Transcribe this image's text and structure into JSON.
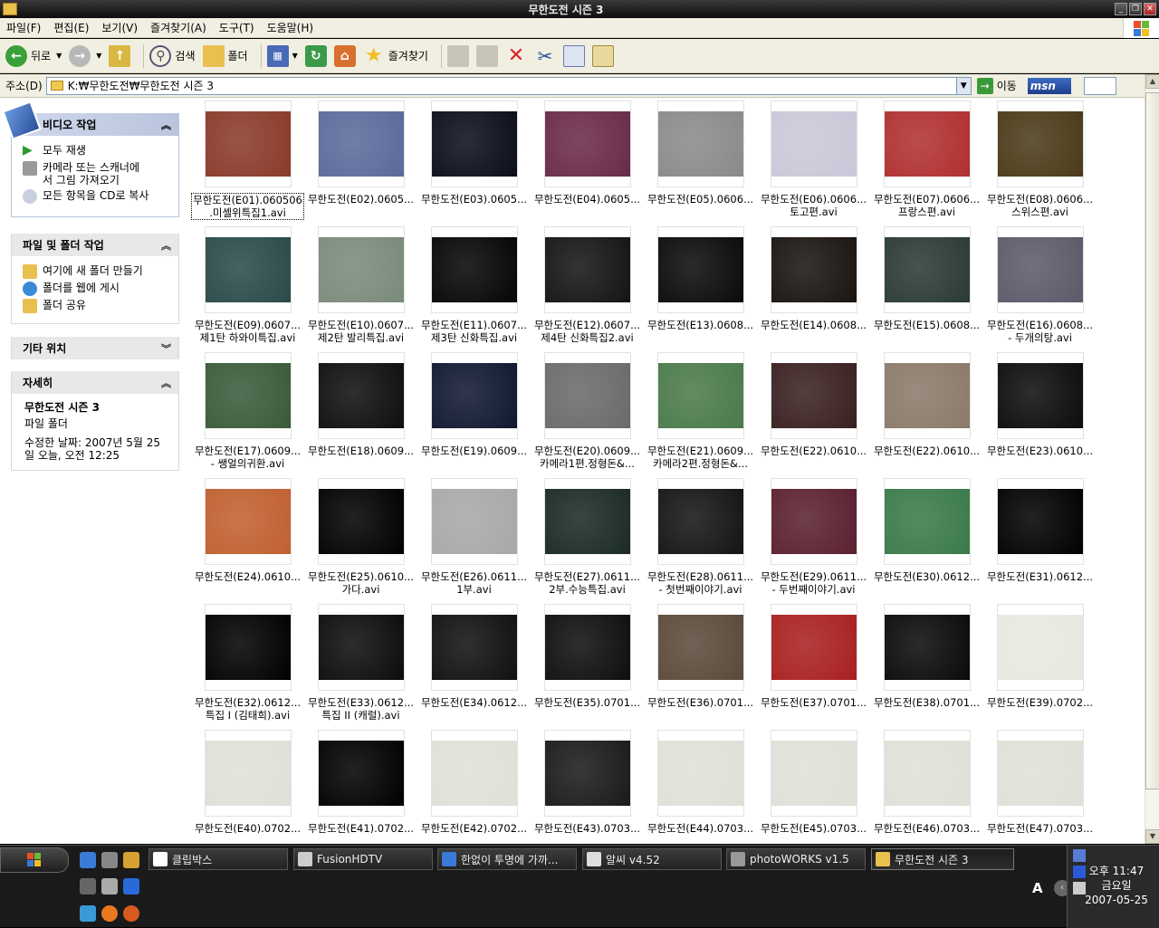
{
  "window": {
    "title": "무한도전 시즌 3"
  },
  "menu": [
    "파일(F)",
    "편집(E)",
    "보기(V)",
    "즐겨찾기(A)",
    "도구(T)",
    "도움말(H)"
  ],
  "toolbar": {
    "back": "뒤로",
    "search": "검색",
    "folders": "폴더",
    "favorites": "즐겨찾기"
  },
  "address": {
    "label": "주소(D)",
    "path": "K:₩무한도전₩무한도전 시즌 3",
    "go": "이동",
    "msn": "msn"
  },
  "sidebar": {
    "video_tasks": {
      "title": "비디오 작업",
      "items": [
        "모두 재생",
        "카메라 또는 스캐너에\n서 그림 가져오기",
        "모든 항목을 CD로 복사"
      ]
    },
    "file_tasks": {
      "title": "파일 및 폴더 작업",
      "items": [
        "여기에 새 폴더 만들기",
        "폴더를 웹에 게시",
        "폴더 공유"
      ]
    },
    "other_places": {
      "title": "기타 위치"
    },
    "details": {
      "title": "자세히",
      "name": "무한도전 시즌 3",
      "type": "파일 폴더",
      "modified": "수정한 날짜: 2007년 5월 25\n일 오늘, 오전 12:25"
    }
  },
  "files": [
    {
      "l1": "무한도전(E01).060506",
      "l2": ".미셸위특집1.avi",
      "c": "#8a3a2a"
    },
    {
      "l1": "무한도전(E02).0605...",
      "l2": "",
      "c": "#5a6a9a"
    },
    {
      "l1": "무한도전(E03).0605...",
      "l2": "",
      "c": "#0a0e1a"
    },
    {
      "l1": "무한도전(E04).0605...",
      "l2": "",
      "c": "#6a2a4a"
    },
    {
      "l1": "무한도전(E05).0606...",
      "l2": "",
      "c": "#8a8a8a"
    },
    {
      "l1": "무한도전(E06).0606...",
      "l2": "토고편.avi",
      "c": "#c8c8d8"
    },
    {
      "l1": "무한도전(E07).0606...",
      "l2": "프랑스편.avi",
      "c": "#b03030"
    },
    {
      "l1": "무한도전(E08).0606...",
      "l2": "스위스편.avi",
      "c": "#4a3a18"
    },
    {
      "l1": "무한도전(E09).0607...",
      "l2": "제1탄 하와이특집.avi",
      "c": "#2a4a4a"
    },
    {
      "l1": "무한도전(E10).0607...",
      "l2": "제2탄 발리특집.avi",
      "c": "#7a8a7a"
    },
    {
      "l1": "무한도전(E11).0607...",
      "l2": "제3탄 신화특집.avi",
      "c": "#050505"
    },
    {
      "l1": "무한도전(E12).0607...",
      "l2": "제4탄 신화특집2.avi",
      "c": "#141414"
    },
    {
      "l1": "무한도전(E13).0608...",
      "l2": "",
      "c": "#0a0a0a"
    },
    {
      "l1": "무한도전(E14).0608...",
      "l2": "",
      "c": "#1a1410"
    },
    {
      "l1": "무한도전(E15).0608...",
      "l2": "",
      "c": "#2a3a34"
    },
    {
      "l1": "무한도전(E16).0608...",
      "l2": "- 두개의탕.avi",
      "c": "#5a5a6a"
    },
    {
      "l1": "무한도전(E17).0609...",
      "l2": "- 쌩얼의귀환.avi",
      "c": "#3a5a3a"
    },
    {
      "l1": "무한도전(E18).0609...",
      "l2": "",
      "c": "#0e0e0e"
    },
    {
      "l1": "무한도전(E19).0609...",
      "l2": "",
      "c": "#101830"
    },
    {
      "l1": "무한도전(E20).0609...",
      "l2": "카메라1편.정형돈&...",
      "c": "#6a6a6a"
    },
    {
      "l1": "무한도전(E21).0609...",
      "l2": "카메라2편.정형돈&...",
      "c": "#4a7a4a"
    },
    {
      "l1": "무한도전(E22).0610...",
      "l2": "",
      "c": "#3a2020"
    },
    {
      "l1": "무한도전(E22).0610...",
      "l2": "",
      "c": "#8a7a6a"
    },
    {
      "l1": "무한도전(E23).0610...",
      "l2": "",
      "c": "#0c0c0c"
    },
    {
      "l1": "무한도전(E24).0610...",
      "l2": "",
      "c": "#c06030"
    },
    {
      "l1": "무한도전(E25).0610...",
      "l2": "가다.avi",
      "c": "#000000"
    },
    {
      "l1": "무한도전(E26).0611...",
      "l2": "1부.avi",
      "c": "#a8a8a8"
    },
    {
      "l1": "무한도전(E27).0611...",
      "l2": "2부.수능특집.avi",
      "c": "#1a2a24"
    },
    {
      "l1": "무한도전(E28).0611...",
      "l2": "- 첫번째이야기.avi",
      "c": "#141414"
    },
    {
      "l1": "무한도전(E29).0611...",
      "l2": "- 두번째이야기.avi",
      "c": "#5a2030"
    },
    {
      "l1": "무한도전(E30).0612...",
      "l2": "",
      "c": "#3a7a4a"
    },
    {
      "l1": "무한도전(E31).0612...",
      "l2": "",
      "c": "#000000"
    },
    {
      "l1": "무한도전(E32).0612...",
      "l2": "특집 I (김태희).avi",
      "c": "#000000"
    },
    {
      "l1": "무한도전(E33).0612...",
      "l2": "특집 II (캐럴).avi",
      "c": "#0c0c0c"
    },
    {
      "l1": "무한도전(E34).0612...",
      "l2": "",
      "c": "#101010"
    },
    {
      "l1": "무한도전(E35).0701...",
      "l2": "",
      "c": "#0e0e0e"
    },
    {
      "l1": "무한도전(E36).0701...",
      "l2": "",
      "c": "#5a4a3a"
    },
    {
      "l1": "무한도전(E37).0701...",
      "l2": "",
      "c": "#a82020"
    },
    {
      "l1": "무한도전(E38).0701...",
      "l2": "",
      "c": "#0a0a0a"
    },
    {
      "l1": "무한도전(E39).0702...",
      "l2": "",
      "c": "#e8e8e0"
    },
    {
      "l1": "무한도전(E40).0702...",
      "l2": "",
      "c": "#e0e0d8"
    },
    {
      "l1": "무한도전(E41).0702...",
      "l2": "",
      "c": "#000000"
    },
    {
      "l1": "무한도전(E42).0702...",
      "l2": "",
      "c": "#e0e0d8"
    },
    {
      "l1": "무한도전(E43).0703...",
      "l2": "",
      "c": "#1a1a1a"
    },
    {
      "l1": "무한도전(E44).0703...",
      "l2": "",
      "c": "#e0e0d8"
    },
    {
      "l1": "무한도전(E45).0703...",
      "l2": "",
      "c": "#e0e0d8"
    },
    {
      "l1": "무한도전(E46).0703...",
      "l2": "",
      "c": "#e0e0d8"
    },
    {
      "l1": "무한도전(E47).0703...",
      "l2": "",
      "c": "#e0e0d8"
    }
  ],
  "taskbar": {
    "tasks": [
      "클립박스",
      "FusionHDTV",
      "한없이 투명에 가까...",
      "알씨 v4.52",
      "photoWORKS v1.5",
      "무한도전 시즌 3"
    ],
    "clock": {
      "time": "오후 11:47",
      "day": "금요일",
      "date": "2007-05-25"
    },
    "ime": "A"
  }
}
